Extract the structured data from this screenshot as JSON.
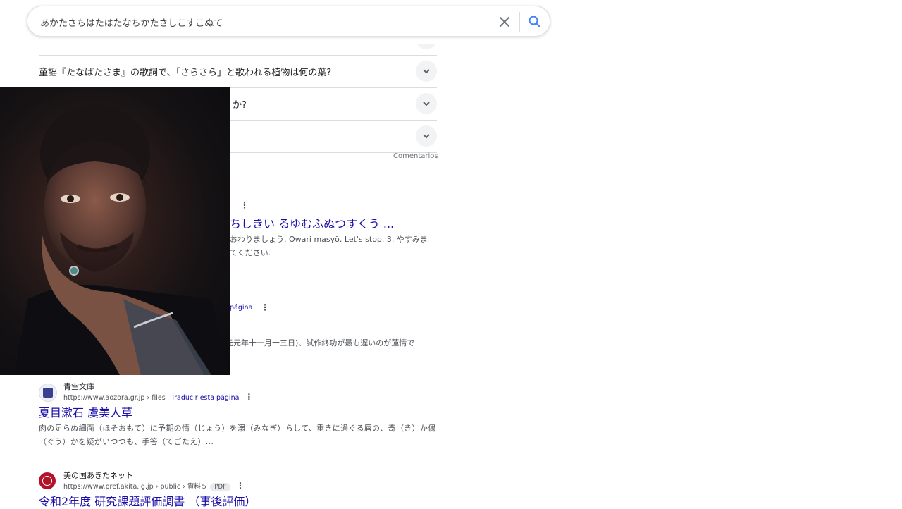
{
  "search": {
    "query": "あかたさちはたはたなちかたさしこすこぬて"
  },
  "faq": {
    "items": [
      {
        "question": "童謡『たなばたさま』の歌詞で、「さらさら」と歌われる植物は何の葉?"
      },
      {
        "question": "か?"
      },
      {
        "question": ""
      }
    ],
    "feedback_label": "Comentarios"
  },
  "partial": {
    "result1_title": "ちしきい るゆむふぬつすくう ...",
    "result1_snippet_line1": "おわりましょう. Owari masyō. Let's stop. 3. やすみま",
    "result1_snippet_line2": "てください.",
    "result2_translate": "página",
    "result2_snippet": "元元年十一月十三日)、試作終功が最も遅いのが蓮情で"
  },
  "results": [
    {
      "site_name": "青空文庫",
      "url_host": "https://www.aozora.gr.jp",
      "url_path": " › files",
      "translate_label": "Traducir esta página",
      "title": "夏目漱石 虞美人草",
      "snippet": "肉の足らぬ細面（ほそおもて）に予期の情（じょう）を溺（みなぎ）らして、重きに過ぐる唇の、奇（き）か偶（ぐう）かを疑がいつつも、手答（てごたえ）..."
    },
    {
      "site_name": "美の国あきたネット",
      "url_host": "https://www.pref.akita.lg.jp",
      "url_path": " › public › 資料５",
      "badge": "PDF",
      "title": "令和2年度 研究課題評価調書 （事後評価）"
    }
  ],
  "colors": {
    "link": "#1a0dab",
    "snippet": "#4d5156",
    "border": "#dadce0"
  }
}
